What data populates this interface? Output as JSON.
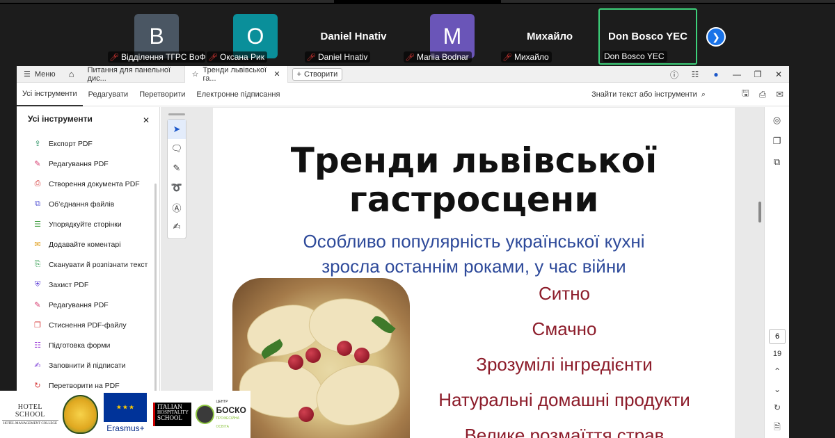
{
  "meeting": {
    "participants": [
      {
        "avatar_letter": "В",
        "label": "Відділення ТГРС ВоФК...",
        "avatar_color": "#4a5663"
      },
      {
        "avatar_letter": "О",
        "label": "Оксана Рик",
        "avatar_color": "#0a8f9a"
      },
      {
        "big_name": "Daniel Hnativ",
        "label": "Daniel Hnativ"
      },
      {
        "avatar_letter": "M",
        "label": "Mariia Bodnar",
        "avatar_color": "#6a55b8"
      },
      {
        "big_name": "Михайло",
        "label": "Михайло"
      },
      {
        "big_name": "Don Bosco YEC",
        "label": "Don Bosco YEC",
        "active": true
      }
    ]
  },
  "window": {
    "menu_label": "Меню",
    "tabs": [
      {
        "title": "Питання для панельної дис..."
      },
      {
        "title": "Тренди львівської га..."
      }
    ],
    "create_label": "Створити"
  },
  "toolbar": {
    "items": [
      "Усі інструменти",
      "Редагувати",
      "Перетворити",
      "Електронне підписання"
    ],
    "search_label": "Знайти текст або інструменти"
  },
  "tools_panel": {
    "title": "Усі інструменти",
    "items": [
      {
        "label": "Експорт PDF",
        "icon": "export-icon",
        "color": "#1e8c5a"
      },
      {
        "label": "Редагування PDF",
        "icon": "edit-icon",
        "color": "#d63a6e"
      },
      {
        "label": "Створення документа PDF",
        "icon": "create-icon",
        "color": "#d63a3a"
      },
      {
        "label": "Об’єднання файлів",
        "icon": "combine-icon",
        "color": "#5a5ad6"
      },
      {
        "label": "Упорядкуйте сторінки",
        "icon": "organize-icon",
        "color": "#3a9a3a"
      },
      {
        "label": "Додавайте коментарі",
        "icon": "comment-icon",
        "color": "#e0a020"
      },
      {
        "label": "Сканувати й розпізнати текст",
        "icon": "scan-icon",
        "color": "#2a9a4a"
      },
      {
        "label": "Захист PDF",
        "icon": "protect-icon",
        "color": "#5a3ad6"
      },
      {
        "label": "Редагування PDF",
        "icon": "redact-icon",
        "color": "#d63a6e"
      },
      {
        "label": "Стиснення PDF-файлу",
        "icon": "compress-icon",
        "color": "#d63a3a"
      },
      {
        "label": "Підготовка форми",
        "icon": "form-icon",
        "color": "#9a3ad6"
      },
      {
        "label": "Заповнити й підписати",
        "icon": "sign-icon",
        "color": "#7a3ad6"
      },
      {
        "label": "Перетворити на PDF",
        "icon": "convert-icon",
        "color": "#d63a3a"
      }
    ]
  },
  "slide": {
    "title_line1": "Тренди львівської",
    "title_line2": "гастросцени",
    "subtitle_line1": "Особливо популярність української кухні",
    "subtitle_line2": "зросла останнім роками, у час війни",
    "points": [
      "Ситно",
      "Смачно",
      "Зрозумілі  інгредієнти",
      "Натуральні домашні продукти",
      "Велике розмаїття страв"
    ]
  },
  "pager": {
    "current": "6",
    "total": "19"
  },
  "logos": {
    "hotel_school": "HOTEL SCHOOL",
    "hotel_school_sub": "HOTEL MANAGEMENT COLLEGE",
    "erasmus": "Erasmus+",
    "ihs_line1": "ITALIAN",
    "ihs_line2": "HOSPITALITY",
    "ihs_line3": "SCHOOL",
    "bosco_top": "ЦЕНТР",
    "bosco_main": "БОСКО",
    "bosco_sub": "ПРОФЕСІЙНА ОСВІТА"
  }
}
